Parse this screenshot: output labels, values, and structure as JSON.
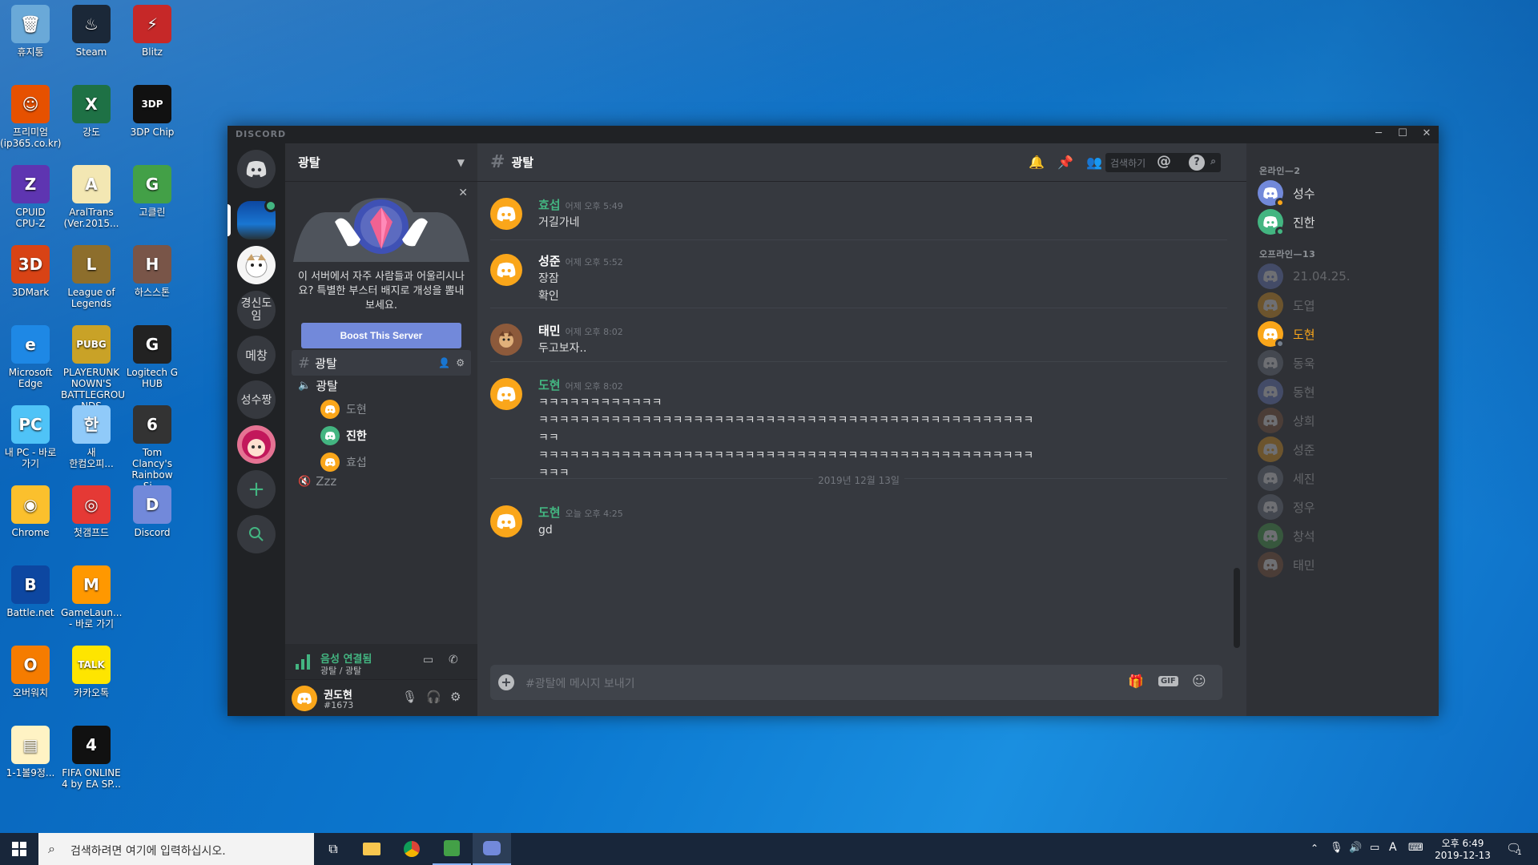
{
  "desktop": {
    "icons": [
      {
        "label": "휴지통",
        "color": "#6aa9d8",
        "glyph": "🗑"
      },
      {
        "label": "Steam",
        "color": "#1b2838",
        "glyph": "♨"
      },
      {
        "label": "Blitz",
        "color": "#c62828",
        "glyph": "⚡"
      },
      {
        "label": "프리미엄\n(ip365.co.kr)",
        "color": "#e65100",
        "glyph": "☺"
      },
      {
        "label": "강도",
        "color": "#1e7145",
        "glyph": "X"
      },
      {
        "label": "3DP Chip",
        "color": "#111111",
        "glyph": "3DP"
      },
      {
        "label": "CPUID\nCPU-Z",
        "color": "#5e35b1",
        "glyph": "Z"
      },
      {
        "label": "AralTrans\n(Ver.2015...",
        "color": "#f3e7b3",
        "glyph": "A"
      },
      {
        "label": "고클린",
        "color": "#43a047",
        "glyph": "G"
      },
      {
        "label": "3DMark",
        "color": "#d84315",
        "glyph": "3D"
      },
      {
        "label": "League of\nLegends",
        "color": "#8d6e2c",
        "glyph": "L"
      },
      {
        "label": "하스스톤",
        "color": "#795548",
        "glyph": "H"
      },
      {
        "label": "Microsoft\nEdge",
        "color": "#1e88e5",
        "glyph": "e"
      },
      {
        "label": "PLAYERUNK\nNOWN'S\nBATTLEGROU\nNDS",
        "color": "#c9a227",
        "glyph": "PUBG"
      },
      {
        "label": "Logitech G\nHUB",
        "color": "#222222",
        "glyph": "G"
      },
      {
        "label": "내 PC - 바로\n가기",
        "color": "#4fc3f7",
        "glyph": "PC"
      },
      {
        "label": "새\n한컴오피...",
        "color": "#90caf9",
        "glyph": "한"
      },
      {
        "label": "Tom Clancy's\nRainbow Si...",
        "color": "#333333",
        "glyph": "6"
      },
      {
        "label": "Chrome",
        "color": "#fbc02d",
        "glyph": "◉"
      },
      {
        "label": "첫갬프드",
        "color": "#e53935",
        "glyph": "◎"
      },
      {
        "label": "Discord",
        "color": "#7289da",
        "glyph": "D"
      },
      {
        "label": "Battle.net",
        "color": "#0d47a1",
        "glyph": "B"
      },
      {
        "label": "GameLaun...\n- 바로 가기",
        "color": "#ff9800",
        "glyph": "M"
      },
      {
        "label": "오버워치",
        "color": "#f57c00",
        "glyph": "O"
      },
      {
        "label": "카카오톡",
        "color": "#fee500",
        "glyph": "TALK"
      },
      {
        "label": "1-1볼9정...",
        "color": "#fff3c4",
        "glyph": "▤"
      },
      {
        "label": "FIFA ONLINE\n4 by EA SP...",
        "color": "#111111",
        "glyph": "4"
      }
    ]
  },
  "window": {
    "brand": "DISCORD",
    "minimize": "─",
    "maximize": "☐",
    "close": "✕"
  },
  "guilds": {
    "items": [
      {
        "label": "",
        "kind": "home"
      },
      {
        "label": "",
        "kind": "img1"
      },
      {
        "label": "",
        "kind": "img2"
      },
      {
        "label": "경신도\n임",
        "kind": "text"
      },
      {
        "label": "메창",
        "kind": "text"
      },
      {
        "label": "성수짱",
        "kind": "text"
      },
      {
        "label": "",
        "kind": "img3"
      }
    ],
    "add": "+",
    "explore": "⌕"
  },
  "server": {
    "name": "광탈",
    "boost_text": "이 서버에서 자주 사람들과 어울리시나요? 특별한 부스터 배지로 개성을 뽐내보세요.",
    "boost_button": "Boost This Server",
    "text_channel": "광탈",
    "voice_channel": "광탈",
    "voice_users": [
      {
        "name": "도현",
        "color": "orange",
        "bold": false
      },
      {
        "name": "진한",
        "color": "green",
        "bold": true
      },
      {
        "name": "효섭",
        "color": "orange",
        "bold": false
      }
    ],
    "afk_channel": "Zzz"
  },
  "voice_status": {
    "title": "음성 연결됨",
    "sub": "광탈 / 광탈"
  },
  "user": {
    "name": "권도현",
    "tag": "#1673"
  },
  "chat": {
    "channel": "광탈",
    "search_placeholder": "검색하기",
    "messages": [
      {
        "author": "효섭",
        "color": "#43b581",
        "ts": "어제 오후 5:49",
        "lines": [
          "거길가네"
        ]
      },
      {
        "author": "성준",
        "color": "#ffffff",
        "ts": "어제 오후 5:52",
        "lines": [
          "장잠",
          "확인"
        ]
      },
      {
        "author": "태민",
        "color": "#ffffff",
        "ts": "어제 오후 8:02",
        "lines": [
          "두고보자.."
        ]
      },
      {
        "author": "도현",
        "color": "#43b581",
        "ts": "어제 오후 8:02",
        "lines": [
          "ㅋㅋㅋㅋㅋㅋㅋㅋㅋㅋㅋㅋ",
          "ㅋㅋㅋㅋㅋㅋㅋㅋㅋㅋㅋㅋㅋㅋㅋㅋㅋㅋㅋㅋㅋㅋㅋㅋㅋㅋㅋㅋㅋㅋㅋㅋㅋㅋㅋㅋㅋㅋㅋㅋㅋㅋㅋㅋㅋㅋㅋㅋ",
          "ㅋㅋ",
          "ㅋㅋㅋㅋㅋㅋㅋㅋㅋㅋㅋㅋㅋㅋㅋㅋㅋㅋㅋㅋㅋㅋㅋㅋㅋㅋㅋㅋㅋㅋㅋㅋㅋㅋㅋㅋㅋㅋㅋㅋㅋㅋㅋㅋㅋㅋㅋㅋ",
          "ㅋㅋㅋ"
        ]
      },
      {
        "author": "도현",
        "color": "#43b581",
        "ts": "오늘 오후 4:25",
        "lines": [
          "gd"
        ]
      }
    ],
    "date_divider": "2019년 12월 13일",
    "input_placeholder": "#광탈에 메시지 보내기",
    "gif": "GIF"
  },
  "members": {
    "online_header": "온라인—2",
    "online": [
      {
        "name": "성수",
        "avatar": "#7289da",
        "status": "#faa61a"
      },
      {
        "name": "진한",
        "avatar": "#43b581",
        "status": "#43b581"
      }
    ],
    "offline_header": "오프라인—13",
    "offline": [
      {
        "name": "21.04.25.",
        "avatar": "#7289da"
      },
      {
        "name": "도엽",
        "avatar": "#faa61a"
      },
      {
        "name": "도현",
        "avatar": "#faa61a",
        "highlight": true
      },
      {
        "name": "동욱",
        "avatar": "#747f8d"
      },
      {
        "name": "동현",
        "avatar": "#7289da"
      },
      {
        "name": "상희",
        "avatar": "#8d5a3b"
      },
      {
        "name": "성준",
        "avatar": "#faa61a"
      },
      {
        "name": "세진",
        "avatar": "#747f8d"
      },
      {
        "name": "정우",
        "avatar": "#747f8d"
      },
      {
        "name": "창석",
        "avatar": "#4caf50"
      },
      {
        "name": "태민",
        "avatar": "#8d5a3b"
      }
    ]
  },
  "taskbar": {
    "search_placeholder": "검색하려면 여기에 입력하십시오.",
    "time": "오후 6:49",
    "date": "2019-12-13",
    "ime": "A",
    "notifications": "1"
  }
}
